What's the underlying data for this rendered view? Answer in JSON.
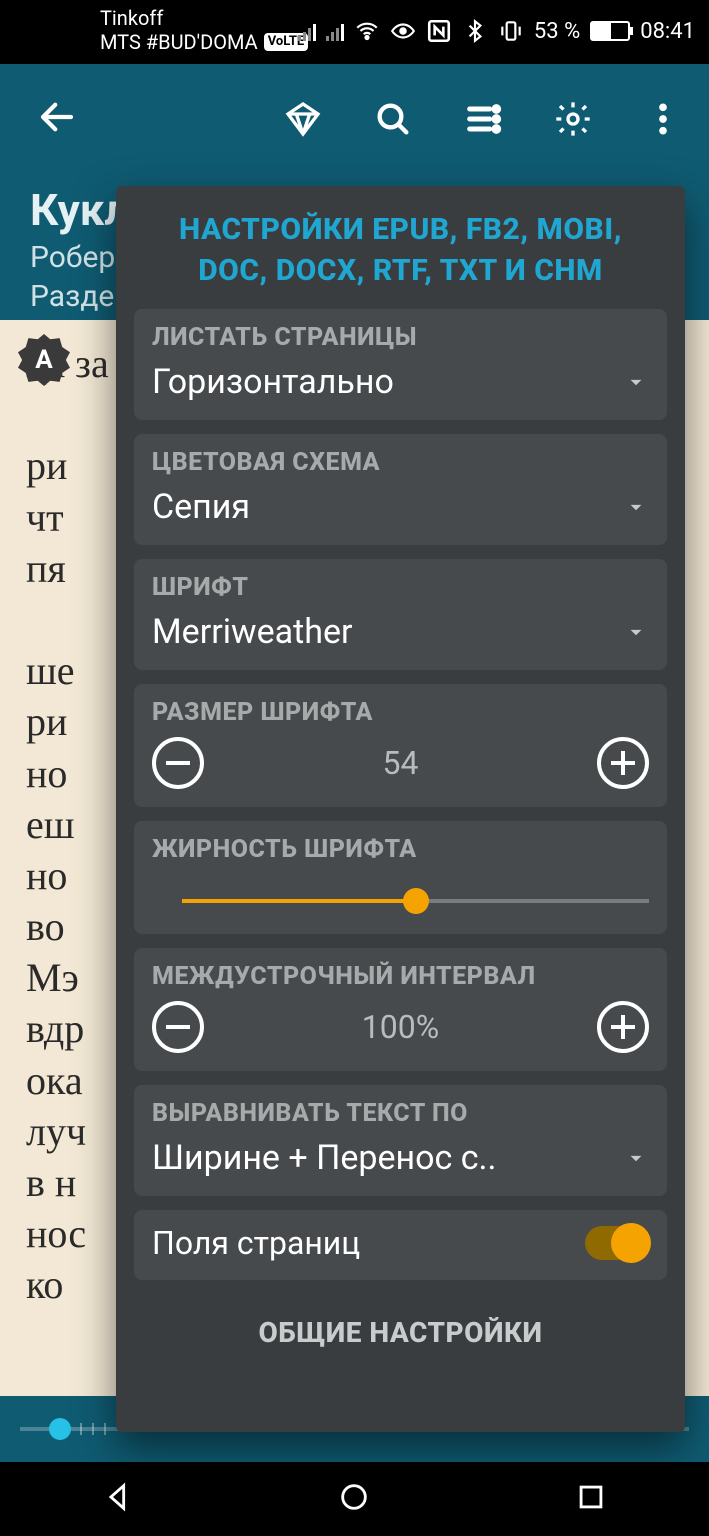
{
  "status": {
    "carrier1": "Tinkoff",
    "carrier2": "MTS #BUD'DOMA",
    "volte": "VoLTE",
    "battery_text": "53 %",
    "time": "08:41"
  },
  "book": {
    "title": "Кукл",
    "author": "Робер",
    "section": "Разде"
  },
  "page_text": "ца за\n\nри\nчт\nпя\n\nше\nри\nно\nеш\nно\nво\nМэ\nвдр\nока\nлуч\nв н\nнос\nко",
  "progress": {
    "percent": 4
  },
  "popover": {
    "title_l1": "НАСТРОЙКИ EPUB, FB2, MOBI,",
    "title_l2": "DOC, DOCX, RTF, TXT И CHM",
    "paging": {
      "label": "ЛИСТАТЬ СТРАНИЦЫ",
      "value": "Горизонтально"
    },
    "theme": {
      "label": "ЦВЕТОВАЯ СХЕМА",
      "value": "Сепия"
    },
    "font": {
      "label": "ШРИФТ",
      "value": "Merriweather"
    },
    "font_size": {
      "label": "РАЗМЕР ШРИФТА",
      "value": "54"
    },
    "weight": {
      "label": "ЖИРНОСТЬ ШРИФТА",
      "percent": 50
    },
    "line": {
      "label": "МЕЖДУСТРОЧНЫЙ ИНТЕРВАЛ",
      "value": "100%"
    },
    "align": {
      "label": "ВЫРАВНИВАТЬ ТЕКСТ ПО",
      "value": "Ширине + Перенос с.."
    },
    "margins": {
      "label": "Поля страниц",
      "on": true
    },
    "footer": "ОБЩИЕ НАСТРОЙКИ"
  }
}
